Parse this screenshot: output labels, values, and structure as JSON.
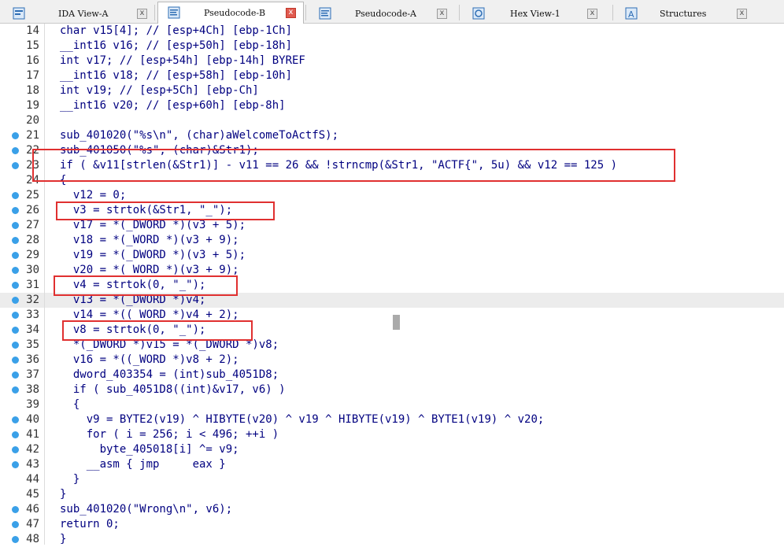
{
  "tabs": [
    {
      "label": "IDA View-A",
      "icon": "ida-view-icon",
      "close": "x"
    },
    {
      "label": "Pseudocode-B",
      "icon": "pseudocode-icon",
      "close": "x",
      "active": true
    },
    {
      "label": "Pseudocode-A",
      "icon": "pseudocode-icon",
      "close": "x"
    },
    {
      "label": "Hex View-1",
      "icon": "hex-view-icon",
      "close": "x"
    },
    {
      "label": "Structures",
      "icon": "structures-icon",
      "close": "x"
    }
  ],
  "colors": {
    "text": "#000080",
    "breakpoint_dot": "#3aa0e8",
    "highlight_box": "#e03030",
    "active_close": "#e05a4f"
  },
  "code_lines": [
    {
      "num": "14",
      "text": "char v15[4]; // [esp+4Ch] [ebp-1Ch]",
      "dot": false
    },
    {
      "num": "15",
      "text": "__int16 v16; // [esp+50h] [ebp-18h]",
      "dot": false
    },
    {
      "num": "16",
      "text": "int v17; // [esp+54h] [ebp-14h] BYREF",
      "dot": false
    },
    {
      "num": "17",
      "text": "__int16 v18; // [esp+58h] [ebp-10h]",
      "dot": false
    },
    {
      "num": "18",
      "text": "int v19; // [esp+5Ch] [ebp-Ch]",
      "dot": false
    },
    {
      "num": "19",
      "text": "__int16 v20; // [esp+60h] [ebp-8h]",
      "dot": false
    },
    {
      "num": "20",
      "text": "",
      "dot": false
    },
    {
      "num": "21",
      "text": "sub_401020(\"%s\\n\", (char)aWelcomeToActfS);",
      "dot": true
    },
    {
      "num": "22",
      "text": "sub_401050(\"%s\", (char)&Str1);",
      "dot": true
    },
    {
      "num": "23",
      "text": "if ( &v11[strlen(&Str1)] - v11 == 26 && !strncmp(&Str1, \"ACTF{\", 5u) && v12 == 125 )",
      "dot": true
    },
    {
      "num": "24",
      "text": "{",
      "dot": false
    },
    {
      "num": "25",
      "text": "  v12 = 0;",
      "dot": true
    },
    {
      "num": "26",
      "text": "  v3 = strtok(&Str1, \"_\");",
      "dot": true
    },
    {
      "num": "27",
      "text": "  v17 = *(_DWORD *)(v3 + 5);",
      "dot": true
    },
    {
      "num": "28",
      "text": "  v18 = *(_WORD *)(v3 + 9);",
      "dot": true
    },
    {
      "num": "29",
      "text": "  v19 = *(_DWORD *)(v3 + 5);",
      "dot": true
    },
    {
      "num": "30",
      "text": "  v20 = *(_WORD *)(v3 + 9);",
      "dot": true
    },
    {
      "num": "31",
      "text": "  v4 = strtok(0, \"_\");",
      "dot": true
    },
    {
      "num": "32",
      "text": "  v13 = *(_DWORD *)v4;",
      "dot": true
    },
    {
      "num": "33",
      "text": "  v14 = *((_WORD *)v4 + 2);",
      "dot": true
    },
    {
      "num": "34",
      "text": "  v8 = strtok(0, \"_\");",
      "dot": true
    },
    {
      "num": "35",
      "text": "  *(_DWORD *)v15 = *(_DWORD *)v8;",
      "dot": true
    },
    {
      "num": "36",
      "text": "  v16 = *((_WORD *)v8 + 2);",
      "dot": true
    },
    {
      "num": "37",
      "text": "  dword_403354 = (int)sub_4051D8;",
      "dot": true
    },
    {
      "num": "38",
      "text": "  if ( sub_4051D8((int)&v17, v6) )",
      "dot": true
    },
    {
      "num": "39",
      "text": "  {",
      "dot": false
    },
    {
      "num": "40",
      "text": "    v9 = BYTE2(v19) ^ HIBYTE(v20) ^ v19 ^ HIBYTE(v19) ^ BYTE1(v19) ^ v20;",
      "dot": true
    },
    {
      "num": "41",
      "text": "    for ( i = 256; i < 496; ++i )",
      "dot": true
    },
    {
      "num": "42",
      "text": "      byte_405018[i] ^= v9;",
      "dot": true
    },
    {
      "num": "43",
      "text": "    __asm { jmp     eax }",
      "dot": true
    },
    {
      "num": "44",
      "text": "  }",
      "dot": false
    },
    {
      "num": "45",
      "text": "}",
      "dot": false
    },
    {
      "num": "46",
      "text": "sub_401020(\"Wrong\\n\", v6);",
      "dot": true
    },
    {
      "num": "47",
      "text": "return 0;",
      "dot": true
    },
    {
      "num": "48",
      "text": "}",
      "dot": true
    }
  ]
}
